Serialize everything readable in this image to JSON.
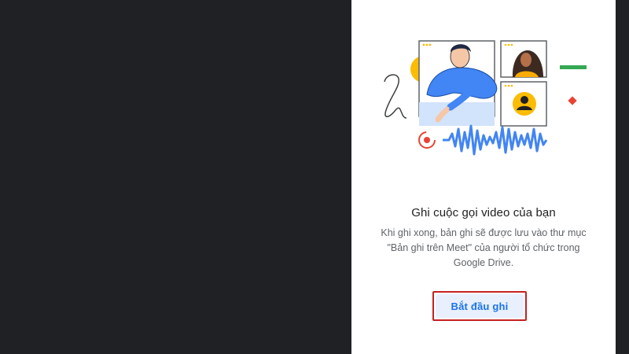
{
  "panel": {
    "title": "Ghi cuộc gọi video của bạn",
    "description": "Khi ghi xong, bản ghi sẽ được lưu vào thư mục \"Bản ghi trên Meet\" của người tổ chức trong Google Drive.",
    "start_button_label": "Bắt đầu ghi"
  },
  "illustration": {
    "icons": [
      "video-tile-person-waving",
      "video-tile-woman",
      "video-tile-avatar",
      "record-icon",
      "audio-waveform",
      "squiggle",
      "yellow-circle",
      "green-dash",
      "red-diamond"
    ]
  },
  "colors": {
    "background": "#202124",
    "panel": "#ffffff",
    "accent_blue": "#1a73e8",
    "button_fill": "#e8f0fe",
    "highlight_border": "#c5221f",
    "title_text": "#202124",
    "body_text": "#5f6368"
  }
}
